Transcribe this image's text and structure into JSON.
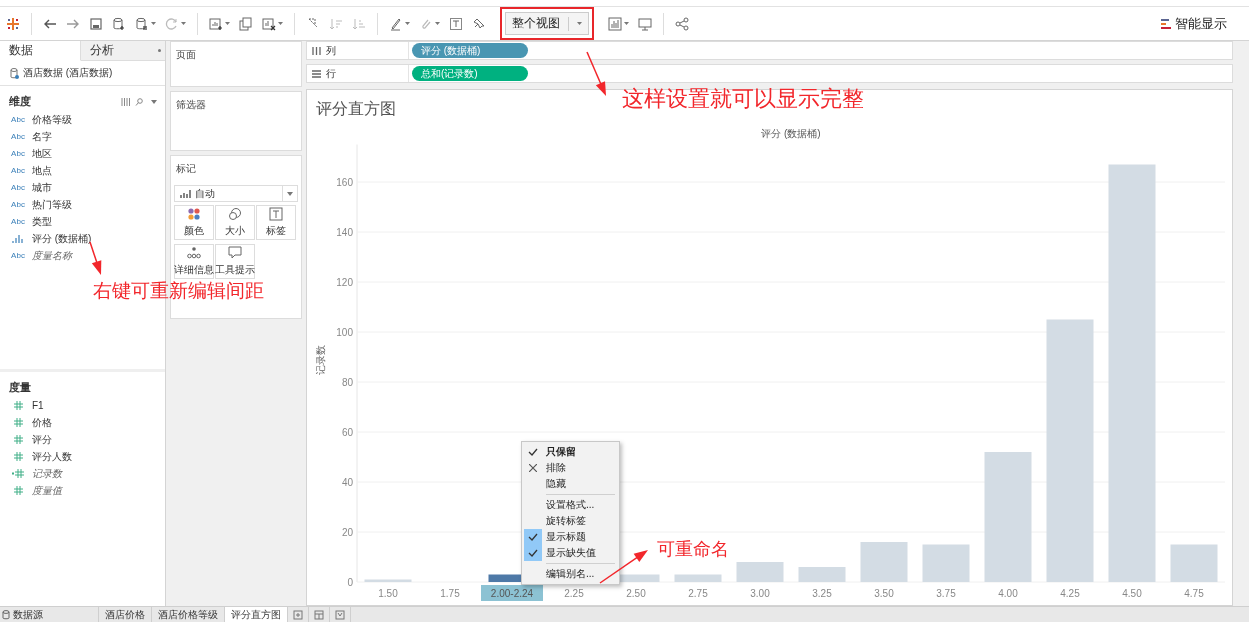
{
  "toolbar": {
    "view_mode": "整个视图",
    "show_me": "智能显示"
  },
  "data_pane": {
    "tabs": [
      {
        "label": "数据",
        "selected": true
      },
      {
        "label": "分析",
        "selected": false
      }
    ],
    "datasource": "酒店数据 (酒店数据)",
    "dimensions": {
      "title": "维度",
      "items": [
        {
          "label": "价格等级",
          "kind": "text",
          "badge": "Abc",
          "generated": false
        },
        {
          "label": "名字",
          "kind": "text",
          "badge": "Abc",
          "generated": false
        },
        {
          "label": "地区",
          "kind": "text",
          "badge": "Abc",
          "generated": false
        },
        {
          "label": "地点",
          "kind": "text",
          "badge": "Abc",
          "generated": false
        },
        {
          "label": "城市",
          "kind": "text",
          "badge": "Abc",
          "generated": false
        },
        {
          "label": "热门等级",
          "kind": "text",
          "badge": "Abc",
          "generated": false
        },
        {
          "label": "类型",
          "kind": "text",
          "badge": "Abc",
          "generated": false
        },
        {
          "label": "评分 (数据桶)",
          "kind": "bin",
          "generated": false
        },
        {
          "label": "度量名称",
          "kind": "text",
          "badge": "Abc",
          "generated": true
        }
      ]
    },
    "measures": {
      "title": "度量",
      "items": [
        {
          "label": "F1",
          "kind": "number",
          "generated": false
        },
        {
          "label": "价格",
          "kind": "number",
          "generated": false
        },
        {
          "label": "评分",
          "kind": "number",
          "generated": false
        },
        {
          "label": "评分人数",
          "kind": "number",
          "generated": false
        },
        {
          "label": "记录数",
          "kind": "count",
          "generated": true
        },
        {
          "label": "度量值",
          "kind": "number",
          "generated": true
        }
      ]
    }
  },
  "cards": {
    "pages": "页面",
    "filters": "筛选器",
    "marks": {
      "title": "标记",
      "mark_type": "自动",
      "buttons": [
        {
          "label": "颜色",
          "kind": "color"
        },
        {
          "label": "大小",
          "kind": "size"
        },
        {
          "label": "标签",
          "kind": "label"
        },
        {
          "label": "详细信息",
          "kind": "detail"
        },
        {
          "label": "工具提示",
          "kind": "tooltip"
        }
      ]
    }
  },
  "shelves": [
    {
      "kind": "columns",
      "label": "列",
      "pill": "评分 (数据桶)",
      "color": "#4996b2"
    },
    {
      "kind": "rows",
      "label": "行",
      "pill": "总和(记录数)",
      "color": "#00b180"
    }
  ],
  "view": {
    "title": "评分直方图",
    "category_selected": [
      false,
      false,
      true,
      false,
      false,
      false,
      false,
      false,
      false,
      false,
      false,
      false,
      false,
      false
    ],
    "chart_data": {
      "type": "bar",
      "title": "评分 (数据桶)",
      "ylabel": "记录数",
      "categories": [
        "1.50",
        "1.75",
        "2.00-2.24",
        "2.25",
        "2.50",
        "2.75",
        "3.00",
        "3.25",
        "3.50",
        "3.75",
        "4.00",
        "4.25",
        "4.50",
        "4.75"
      ],
      "values": [
        1,
        0,
        3,
        null,
        3,
        3,
        8,
        6,
        16,
        15,
        52,
        105,
        167,
        15
      ],
      "grid": true,
      "ylim": [
        0,
        175
      ],
      "yticks": [
        0,
        20,
        40,
        60,
        80,
        100,
        120,
        140,
        160
      ]
    }
  },
  "context_menu": {
    "items": [
      {
        "kind": "keep",
        "label": "只保留",
        "default": true
      },
      {
        "kind": "exclude",
        "label": "排除",
        "default": false
      },
      {
        "kind": "action",
        "label": "隐藏",
        "default": false
      },
      {
        "kind": "separator"
      },
      {
        "kind": "action",
        "label": "设置格式...",
        "default": false
      },
      {
        "kind": "action",
        "label": "旋转标签",
        "default": false
      },
      {
        "kind": "toggle",
        "label": "显示标题",
        "checked": true
      },
      {
        "kind": "toggle",
        "label": "显示缺失值",
        "checked": true
      },
      {
        "kind": "separator"
      },
      {
        "kind": "action",
        "label": "编辑别名...",
        "default": false
      }
    ]
  },
  "sheet_tabs": [
    {
      "kind": "datasource",
      "label": "数据源",
      "selected": false
    },
    {
      "kind": "sheet",
      "label": "酒店价格",
      "selected": false
    },
    {
      "kind": "sheet",
      "label": "酒店价格等级",
      "selected": false
    },
    {
      "kind": "sheet",
      "label": "评分直方图",
      "selected": true
    }
  ],
  "annotations": [
    {
      "text": "这样设置就可以显示完整"
    },
    {
      "text": "右键可重新编辑间距"
    },
    {
      "text": "可重命名"
    }
  ]
}
